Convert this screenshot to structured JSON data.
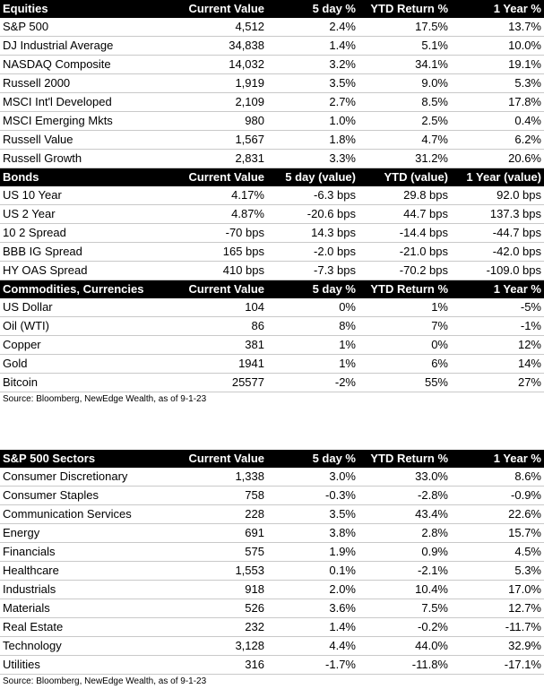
{
  "equities": {
    "headers": [
      "Equities",
      "Current Value",
      "5 day %",
      "YTD Return %",
      "1 Year %"
    ],
    "rows": [
      [
        "S&P 500",
        "4,512",
        "2.4%",
        "17.5%",
        "13.7%"
      ],
      [
        "DJ Industrial Average",
        "34,838",
        "1.4%",
        "5.1%",
        "10.0%"
      ],
      [
        "NASDAQ Composite",
        "14,032",
        "3.2%",
        "34.1%",
        "19.1%"
      ],
      [
        "Russell 2000",
        "1,919",
        "3.5%",
        "9.0%",
        "5.3%"
      ],
      [
        "MSCI Int'l Developed",
        "2,109",
        "2.7%",
        "8.5%",
        "17.8%"
      ],
      [
        "MSCI Emerging Mkts",
        "980",
        "1.0%",
        "2.5%",
        "0.4%"
      ],
      [
        "Russell Value",
        "1,567",
        "1.8%",
        "4.7%",
        "6.2%"
      ],
      [
        "Russell Growth",
        "2,831",
        "3.3%",
        "31.2%",
        "20.6%"
      ]
    ]
  },
  "bonds": {
    "headers": [
      "Bonds",
      "Current Value",
      "5 day (value)",
      "YTD (value)",
      "1 Year (value)"
    ],
    "rows": [
      [
        "US 10 Year",
        "4.17%",
        "-6.3 bps",
        "29.8 bps",
        "92.0 bps"
      ],
      [
        "US 2 Year",
        "4.87%",
        "-20.6 bps",
        "44.7 bps",
        "137.3 bps"
      ],
      [
        "10 2 Spread",
        "-70 bps",
        "14.3 bps",
        "-14.4 bps",
        "-44.7 bps"
      ],
      [
        "BBB IG Spread",
        "165 bps",
        "-2.0 bps",
        "-21.0 bps",
        "-42.0 bps"
      ],
      [
        "HY OAS Spread",
        "410 bps",
        "-7.3 bps",
        "-70.2 bps",
        "-109.0 bps"
      ]
    ]
  },
  "commodities": {
    "headers": [
      "Commodities, Currencies",
      "Current Value",
      "5 day %",
      "YTD Return %",
      "1 Year %"
    ],
    "rows": [
      [
        "US Dollar",
        "104",
        "0%",
        "1%",
        "-5%"
      ],
      [
        "Oil (WTI)",
        "86",
        "8%",
        "7%",
        "-1%"
      ],
      [
        "Copper",
        "381",
        "1%",
        "0%",
        "12%"
      ],
      [
        "Gold",
        "1941",
        "1%",
        "6%",
        "14%"
      ],
      [
        "Bitcoin",
        "25577",
        "-2%",
        "55%",
        "27%"
      ]
    ]
  },
  "source_1": "Source: Bloomberg, NewEdge Wealth, as of 9-1-23",
  "sectors": {
    "headers": [
      "S&P 500 Sectors",
      "Current Value",
      "5 day %",
      "YTD Return %",
      "1 Year %"
    ],
    "rows": [
      [
        "Consumer Discretionary",
        "1,338",
        "3.0%",
        "33.0%",
        "8.6%"
      ],
      [
        "Consumer Staples",
        "758",
        "-0.3%",
        "-2.8%",
        "-0.9%"
      ],
      [
        "Communication Services",
        "228",
        "3.5%",
        "43.4%",
        "22.6%"
      ],
      [
        "Energy",
        "691",
        "3.8%",
        "2.8%",
        "15.7%"
      ],
      [
        "Financials",
        "575",
        "1.9%",
        "0.9%",
        "4.5%"
      ],
      [
        "Healthcare",
        "1,553",
        "0.1%",
        "-2.1%",
        "5.3%"
      ],
      [
        "Industrials",
        "918",
        "2.0%",
        "10.4%",
        "17.0%"
      ],
      [
        "Materials",
        "526",
        "3.6%",
        "7.5%",
        "12.7%"
      ],
      [
        "Real Estate",
        "232",
        "1.4%",
        "-0.2%",
        "-11.7%"
      ],
      [
        "Technology",
        "3,128",
        "4.4%",
        "44.0%",
        "32.9%"
      ],
      [
        "Utilities",
        "316",
        "-1.7%",
        "-11.8%",
        "-17.1%"
      ]
    ]
  },
  "source_2": "Source: Bloomberg, NewEdge Wealth, as of 9-1-23"
}
